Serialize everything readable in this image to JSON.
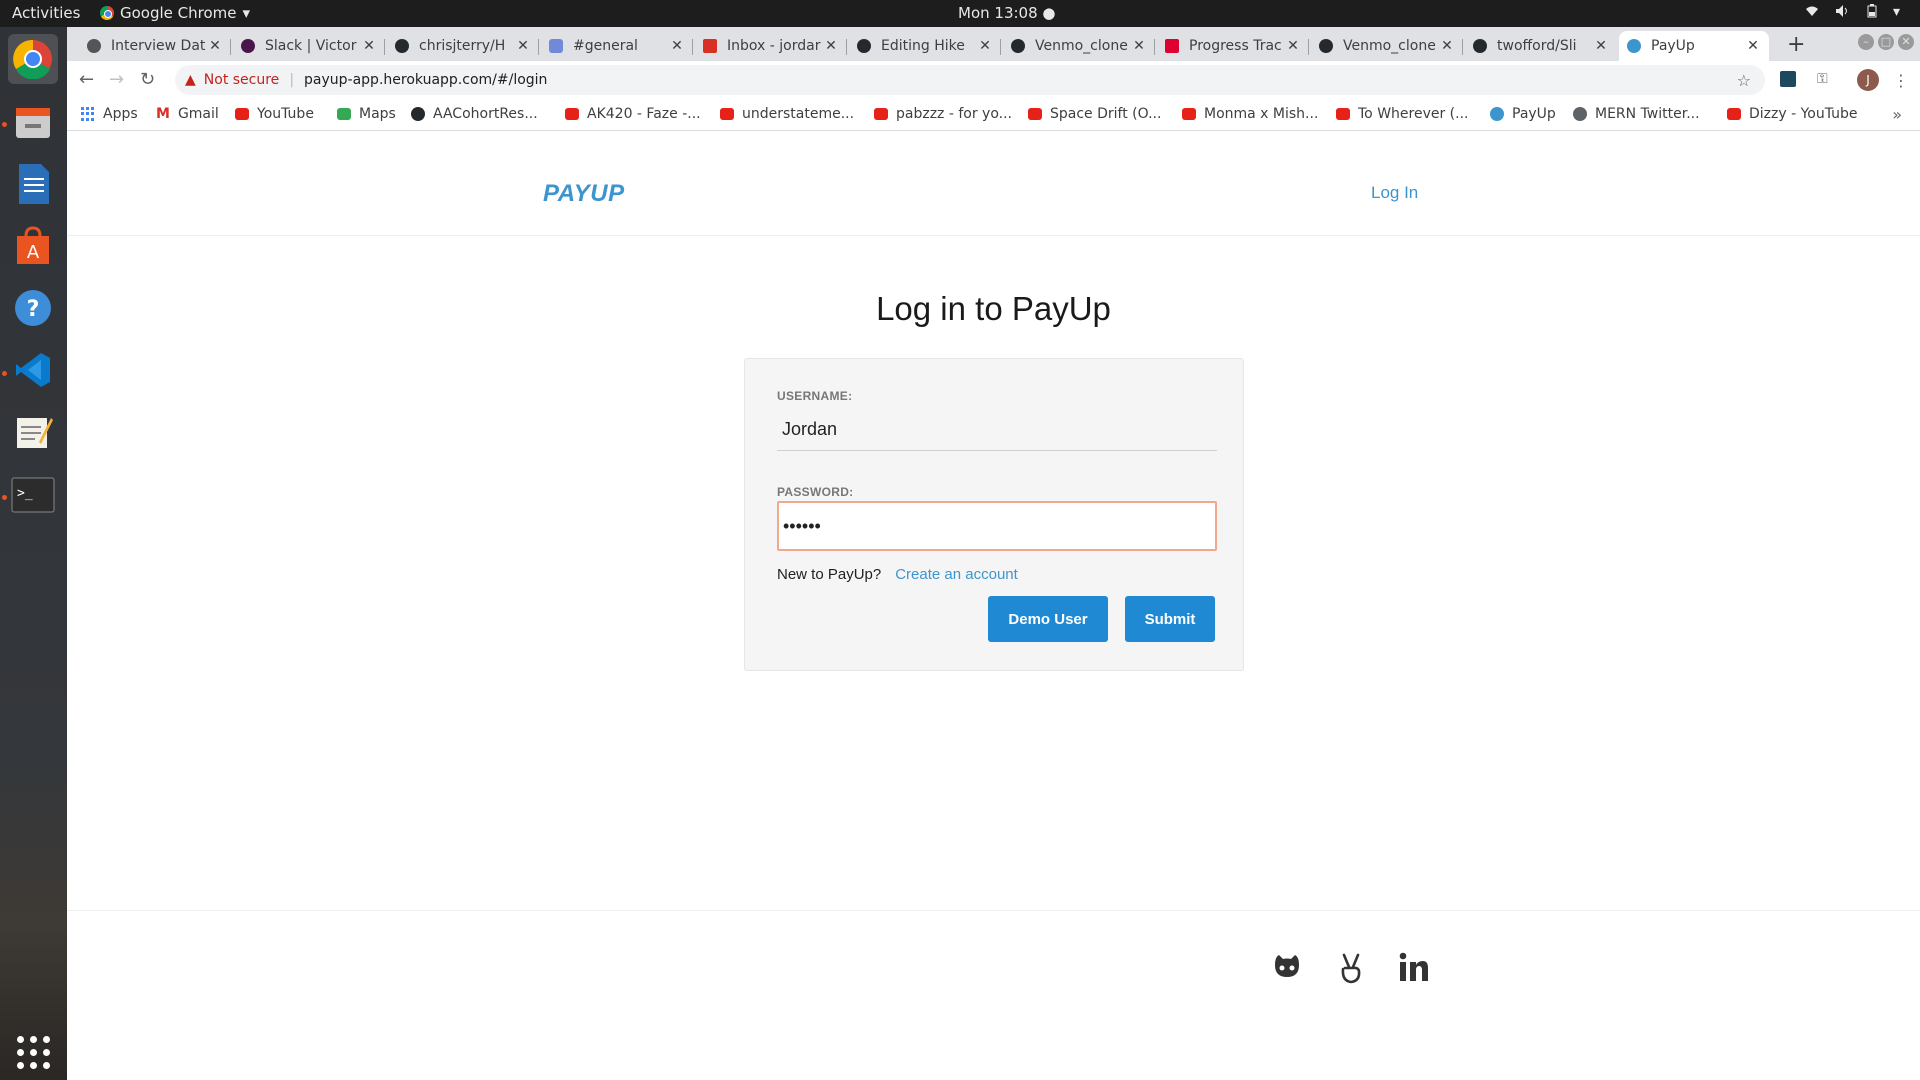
{
  "system": {
    "activities": "Activities",
    "app_name": "Google Chrome",
    "clock": "Mon 13:08 ●"
  },
  "browser": {
    "tabs": [
      {
        "title": "Interview Dat"
      },
      {
        "title": "Slack | Victor"
      },
      {
        "title": "chrisjterry/H"
      },
      {
        "title": "#general"
      },
      {
        "title": "Inbox - jordar"
      },
      {
        "title": "Editing Hike"
      },
      {
        "title": "Venmo_clone"
      },
      {
        "title": "Progress Trac"
      },
      {
        "title": "Venmo_clone"
      },
      {
        "title": "twofford/Sli"
      },
      {
        "title": "PayUp"
      }
    ],
    "security_label": "Not secure",
    "url": "payup-app.herokuapp.com/#/login",
    "profile_initial": "J",
    "bookmarks": [
      {
        "label": "Apps",
        "icon": "apps-icon"
      },
      {
        "label": "Gmail",
        "icon": "gmail-icon"
      },
      {
        "label": "YouTube",
        "icon": "youtube-icon"
      },
      {
        "label": "Maps",
        "icon": "maps-icon"
      },
      {
        "label": "AACohortRes...",
        "icon": "github-icon"
      },
      {
        "label": "AK420 - Faze -...",
        "icon": "youtube-icon"
      },
      {
        "label": "understateme...",
        "icon": "youtube-icon"
      },
      {
        "label": "pabzzz - for yo...",
        "icon": "youtube-icon"
      },
      {
        "label": "Space Drift (O...",
        "icon": "youtube-icon"
      },
      {
        "label": "Monma x Mish...",
        "icon": "youtube-icon"
      },
      {
        "label": "To Wherever (...",
        "icon": "youtube-icon"
      },
      {
        "label": "PayUp",
        "icon": "payup-icon"
      },
      {
        "label": "MERN Twitter...",
        "icon": "globe-icon"
      },
      {
        "label": "Dizzy - YouTube",
        "icon": "youtube-icon"
      }
    ]
  },
  "site": {
    "logo": "PAYUP",
    "nav_login": "Log In",
    "heading": "Log in to PayUp",
    "username_label": "USERNAME:",
    "username_value": "Jordan",
    "password_label": "PASSWORD:",
    "password_value": "••••••",
    "signup_prompt": "New to PayUp?",
    "signup_link": "Create an account",
    "demo_button": "Demo User",
    "submit_button": "Submit"
  },
  "colors": {
    "brand": "#3d95ce",
    "button": "#1f8ad3",
    "focus_border": "#f0a98c",
    "insecure": "#c5221f"
  }
}
